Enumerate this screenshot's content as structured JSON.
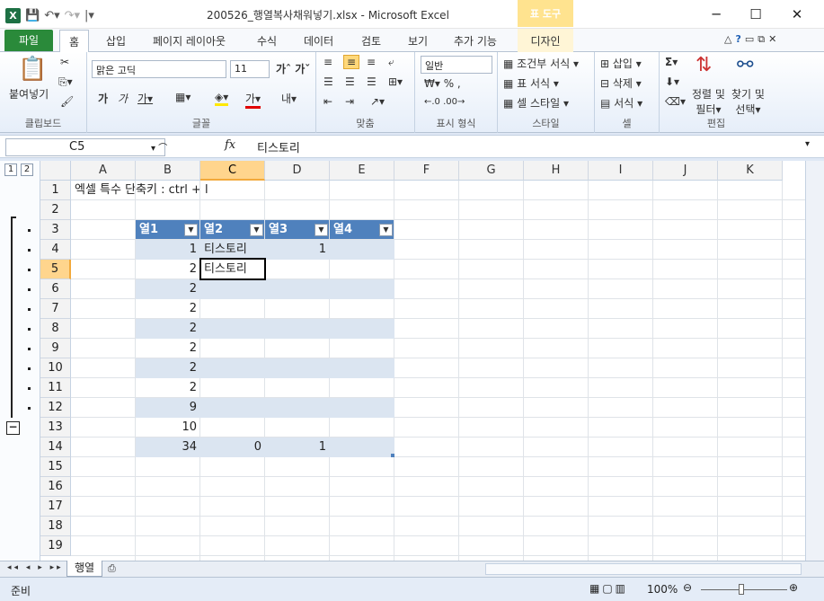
{
  "window": {
    "title": "200526_행열복사채워넣기.xlsx  -  Microsoft Excel",
    "context_tab_group": "표 도구"
  },
  "tabs": {
    "file": "파일",
    "home": "홈",
    "insert": "삽입",
    "page_layout": "페이지 레이아웃",
    "formulas": "수식",
    "data": "데이터",
    "review": "검토",
    "view": "보기",
    "addins": "추가 기능",
    "design": "디자인"
  },
  "ribbon": {
    "clipboard": {
      "label": "클립보드",
      "paste": "붙여넣기"
    },
    "font": {
      "label": "글꼴",
      "name": "맑은 고딕",
      "size": "11"
    },
    "alignment": {
      "label": "맞춤"
    },
    "number": {
      "label": "표시 형식",
      "format": "일반"
    },
    "styles": {
      "label": "스타일",
      "conditional": "조건부 서식",
      "table": "표 서식",
      "cell": "셀 스타일"
    },
    "cells": {
      "label": "셀",
      "insert": "삽입",
      "delete": "삭제",
      "format": "서식"
    },
    "editing": {
      "label": "편집",
      "sort1": "정렬 및",
      "sort2": "필터",
      "find1": "찾기 및",
      "find2": "선택"
    }
  },
  "formula_bar": {
    "name_box": "C5",
    "fx": "fx",
    "value": "티스토리"
  },
  "outline_levels": [
    "1",
    "2"
  ],
  "columns": [
    "A",
    "B",
    "C",
    "D",
    "E",
    "F",
    "G",
    "H",
    "I",
    "J",
    "K"
  ],
  "rows": [
    "1",
    "2",
    "3",
    "4",
    "5",
    "6",
    "7",
    "8",
    "9",
    "10",
    "11",
    "12",
    "13",
    "14",
    "15",
    "16",
    "17",
    "18",
    "19"
  ],
  "sheet": {
    "a1": "엑셀 특수 단축키 : ctrl + l",
    "headers": [
      "열1",
      "열2",
      "열3",
      "열4"
    ],
    "col_b": [
      "1",
      "2",
      "2",
      "2",
      "2",
      "2",
      "2",
      "2",
      "9",
      "10",
      "34"
    ],
    "col_c": {
      "r4": "티스토리",
      "r5": "티스토리",
      "r14": "0"
    },
    "col_d": {
      "r4": "1",
      "r14": "1"
    }
  },
  "sheet_tab": "행열",
  "status": {
    "ready": "준비",
    "zoom": "100%"
  },
  "colors": {
    "accent": "#4f81bd",
    "band": "#dbe5f1",
    "file_tab": "#2a8a3a"
  }
}
